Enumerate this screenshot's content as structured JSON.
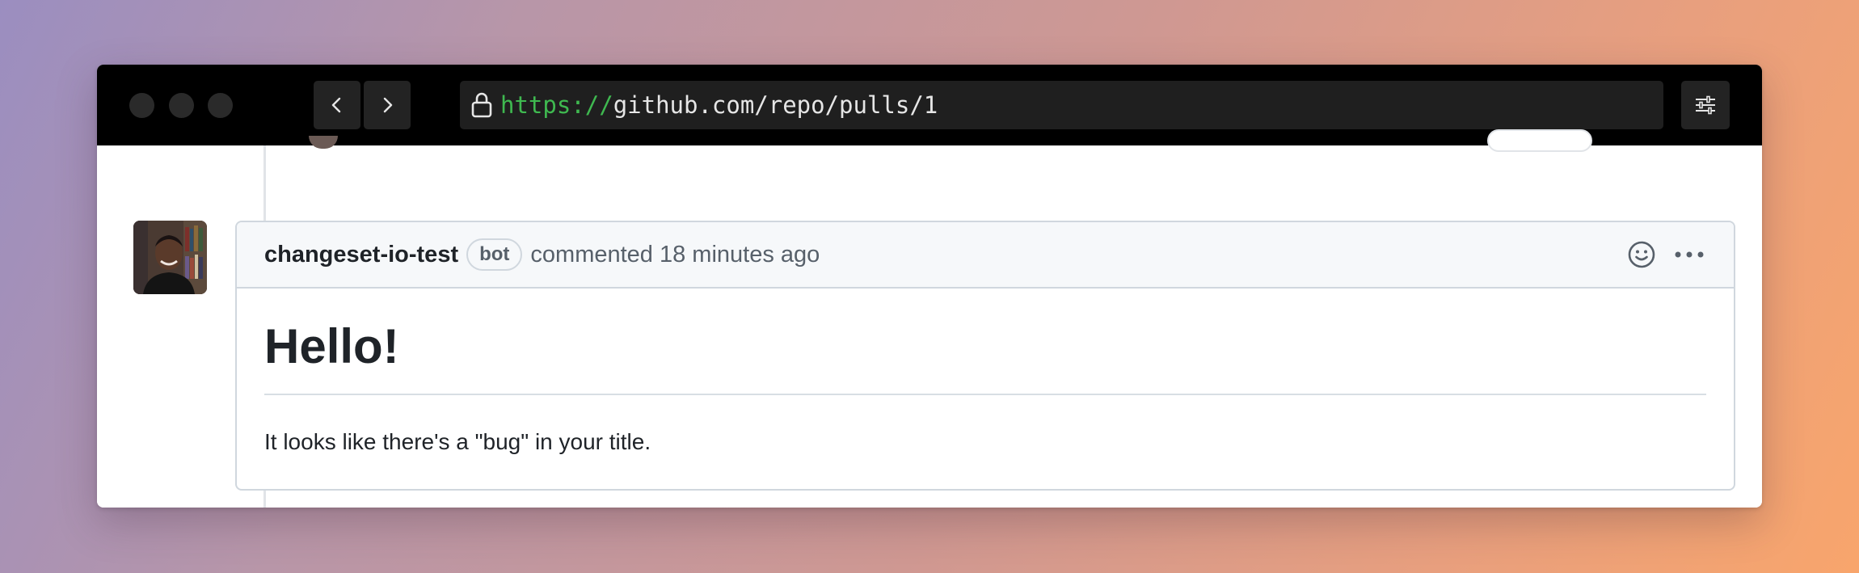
{
  "browser": {
    "url_scheme": "https://",
    "url_rest": "github.com/repo/pulls/1",
    "icons": {
      "back": "chevron-left-icon",
      "forward": "chevron-right-icon",
      "lock": "lock-icon",
      "menu": "sliders-icon"
    }
  },
  "comment": {
    "author": "changeset-io-test",
    "badge": "bot",
    "meta": "commented 18 minutes ago",
    "heading": "Hello!",
    "body": "It looks like there's a \"bug\" in your title.",
    "icons": {
      "reaction": "smiley-icon",
      "more": "kebab-horizontal-icon"
    }
  },
  "colors": {
    "url_scheme": "#3fb950",
    "titlebar": "#000000",
    "comment_header_bg": "#f6f8fa",
    "border": "#d0d7de"
  }
}
